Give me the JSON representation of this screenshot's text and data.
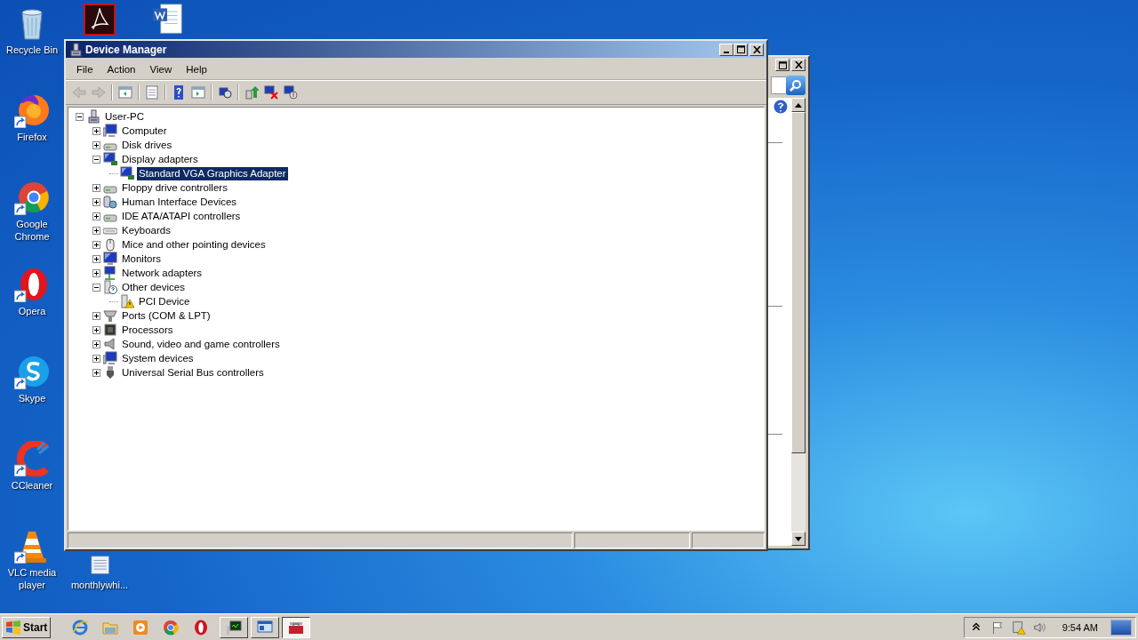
{
  "desktop_icons": [
    {
      "kind": "recycle",
      "label": "Recycle Bin"
    },
    {
      "kind": "pdf"
    },
    {
      "kind": "word"
    },
    {
      "kind": "firefox",
      "label": "Firefox"
    },
    {
      "kind": "chrome",
      "label": "Google Chrome"
    },
    {
      "kind": "opera",
      "label": "Opera"
    },
    {
      "kind": "skype",
      "label": "Skype"
    },
    {
      "kind": "ccleaner",
      "label": "CCleaner"
    },
    {
      "kind": "vlc",
      "label": "VLC media player"
    },
    {
      "kind": "text",
      "label": "monthlywhi..."
    }
  ],
  "device_manager": {
    "title": "Device Manager",
    "menu": [
      "File",
      "Action",
      "View",
      "Help"
    ],
    "toolbar": [
      {
        "kind": "back",
        "disabled": true
      },
      {
        "kind": "forward",
        "disabled": true
      },
      {
        "kind": "tree-pane",
        "disabled": false
      },
      {
        "kind": "properties",
        "disabled": false
      },
      {
        "kind": "help",
        "disabled": false
      },
      {
        "kind": "action-pane",
        "disabled": false
      },
      {
        "kind": "scan",
        "disabled": false
      },
      {
        "kind": "update",
        "disabled": false
      },
      {
        "kind": "uninstall",
        "disabled": false
      },
      {
        "kind": "disable",
        "disabled": false
      }
    ],
    "tree": {
      "label": "User-PC",
      "kind": "pc",
      "expanded": true,
      "selected": false,
      "children": [
        {
          "label": "Computer",
          "kind": "computer",
          "expanded": false,
          "selected": false
        },
        {
          "label": "Disk drives",
          "kind": "drive",
          "expanded": false,
          "selected": false
        },
        {
          "label": "Display adapters",
          "kind": "display",
          "expanded": true,
          "selected": false,
          "children": [
            {
              "label": "Standard VGA Graphics Adapter",
              "kind": "display",
              "selected": true
            }
          ]
        },
        {
          "label": "Floppy drive controllers",
          "kind": "drive",
          "expanded": false,
          "selected": false
        },
        {
          "label": "Human Interface Devices",
          "kind": "hid",
          "expanded": false,
          "selected": false
        },
        {
          "label": "IDE ATA/ATAPI controllers",
          "kind": "drive",
          "expanded": false,
          "selected": false
        },
        {
          "label": "Keyboards",
          "kind": "keyboard",
          "expanded": false,
          "selected": false
        },
        {
          "label": "Mice and other pointing devices",
          "kind": "mouse",
          "expanded": false,
          "selected": false
        },
        {
          "label": "Monitors",
          "kind": "monitor",
          "expanded": false,
          "selected": false
        },
        {
          "label": "Network adapters",
          "kind": "network",
          "expanded": false,
          "selected": false
        },
        {
          "label": "Other devices",
          "kind": "other",
          "expanded": true,
          "selected": false,
          "children": [
            {
              "label": "PCI Device",
              "kind": "warning",
              "selected": false
            }
          ]
        },
        {
          "label": "Ports (COM & LPT)",
          "kind": "port",
          "expanded": false,
          "selected": false
        },
        {
          "label": "Processors",
          "kind": "cpu",
          "expanded": false,
          "selected": false
        },
        {
          "label": "Sound, video and game controllers",
          "kind": "sound",
          "expanded": false,
          "selected": false
        },
        {
          "label": "System devices",
          "kind": "computer",
          "expanded": false,
          "selected": false
        },
        {
          "label": "Universal Serial Bus controllers",
          "kind": "usb",
          "expanded": false,
          "selected": false
        }
      ]
    }
  },
  "taskbar": {
    "start": "Start",
    "pinned": [
      {
        "kind": "ie"
      },
      {
        "kind": "explorer"
      },
      {
        "kind": "media"
      },
      {
        "kind": "chrome"
      },
      {
        "kind": "opera"
      }
    ],
    "tasks": [
      {
        "kind": "monitor",
        "selected": false
      },
      {
        "kind": "remote",
        "selected": false
      },
      {
        "kind": "toolbox",
        "selected": true
      }
    ],
    "tray": [
      {
        "kind": "chevron"
      },
      {
        "kind": "flag"
      },
      {
        "kind": "network-warning"
      },
      {
        "kind": "speaker"
      }
    ],
    "clock": "9:54 AM"
  }
}
